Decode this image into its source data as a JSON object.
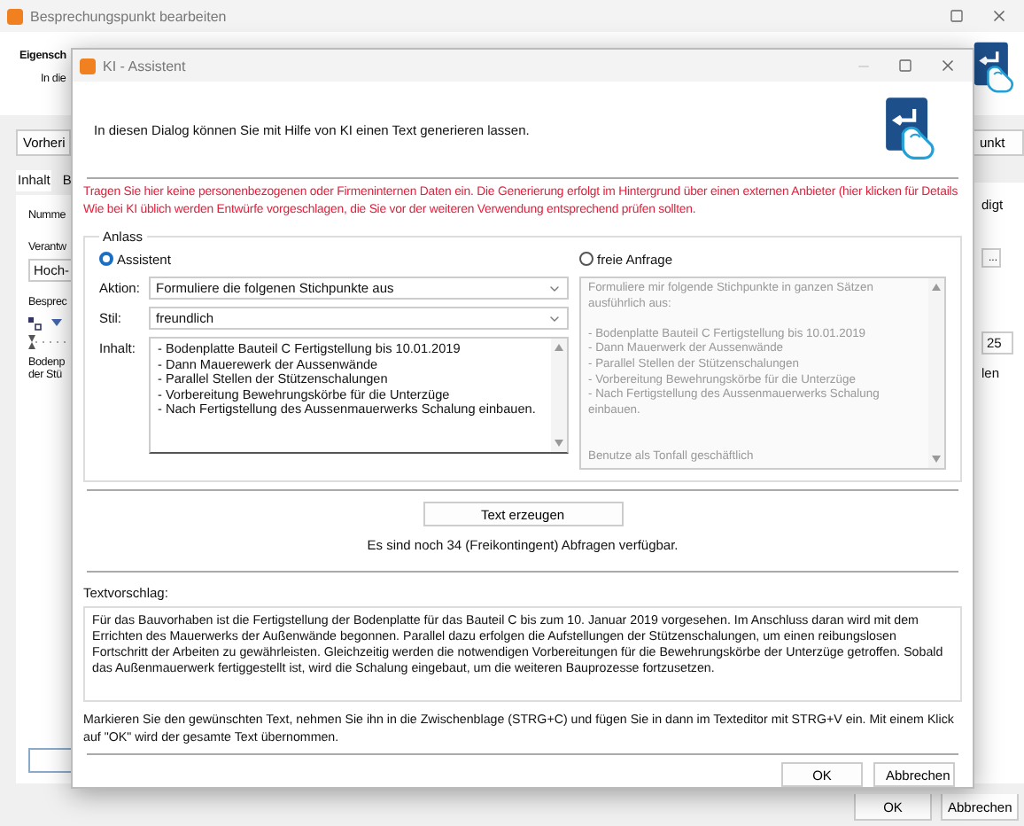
{
  "background_window": {
    "title": "Besprechungspunkt bearbeiten",
    "heading": "Eigensch",
    "intro": "In die",
    "prev_button": "Vorheri",
    "next_button": "unkt",
    "tabs": [
      {
        "label": "Inhalt",
        "selected": true
      },
      {
        "label": "B",
        "selected": false
      }
    ],
    "number_label": "Numme",
    "status_text": "digt",
    "responsible_label": "Verantw",
    "responsible_value": "Hoch-",
    "browse_button": "...",
    "section_label": "Besprec",
    "ruler_value": "25",
    "body_lines": [
      "Bodenp",
      "der Stü"
    ],
    "body_right": "len",
    "buttons": [
      "OK",
      "Abbrechen"
    ]
  },
  "dialog": {
    "title": "KI - Assistent",
    "intro": "In diesen Dialog können Sie mit Hilfe von KI einen Text generieren lassen.",
    "warning": [
      "Tragen Sie hier keine personenbezogenen oder Firmeninternen Daten ein. Die Generierung erfolgt im Hintergrund über einen externen Anbieter (hier klicken für Details",
      "Wie bei KI üblich werden Entwürfe vorgeschlagen, die Sie vor der weiteren Verwendung entsprechend prüfen sollten."
    ],
    "group_label": "Anlass",
    "modes": [
      {
        "label": "Assistent",
        "selected": true
      },
      {
        "label": "freie Anfrage",
        "selected": false
      }
    ],
    "action": {
      "label": "Aktion:",
      "value": "Formuliere die folgenen Stichpunkte aus"
    },
    "style": {
      "label": "Stil:",
      "value": "freundlich"
    },
    "content": {
      "label": "Inhalt:",
      "value": "- Bodenplatte Bauteil C Fertigstellung bis 10.01.2019\n- Dann Mauerewerk der Aussenwände\n- Parallel Stellen der Stützenschalungen\n- Vorbereitung Bewehrungskörbe für die Unterzüge\n- Nach Fertigstellung des Aussenmauerwerks Schalung einbauen."
    },
    "free_request": {
      "disabled": true,
      "value": "Formuliere mir folgende Stichpunkte in ganzen Sätzen ausführlich aus:\n\n- Bodenplatte Bauteil C Fertigstellung bis 10.01.2019\n- Dann Mauerwerk der Aussenwände\n- Parallel Stellen der Stützenschalungen\n- Vorbereitung Bewehrungskörbe für die Unterzüge\n- Nach Fertigstellung des Aussenmauerwerks Schalung einbauen.\n\n\nBenutze als Tonfall geschäftlich"
    },
    "generate_button": "Text erzeugen",
    "quota": "Es sind noch 34 (Freikontingent) Abfragen verfügbar.",
    "suggestion_label": "Textvorschlag:",
    "suggestion": "Für das Bauvorhaben ist die Fertigstellung der Bodenplatte für das Bauteil C bis zum 10. Januar 2019 vorgesehen. Im Anschluss daran wird mit dem Errichten des Mauerwerks der Außenwände begonnen. Parallel dazu erfolgen die Aufstellungen der Stützenschalungen, um einen reibungslosen Fortschritt der Arbeiten zu gewährleisten. Gleichzeitig werden die notwendigen Vorbereitungen für die Bewehrungskörbe der Unterzüge getroffen. Sobald das Außenmauerwerk fertiggestellt ist, wird die Schalung eingebaut, um die weiteren Bauprozesse fortzusetzen.",
    "note": "Markieren Sie den gewünschten Text, nehmen Sie ihn in die Zwischenblage (STRG+C) und fügen Sie in dann im Texteditor mit STRG+V ein. Mit einem Klick auf \"OK\" wird der gesamte Text übernommen.",
    "buttons": [
      "OK",
      "Abbrechen"
    ]
  }
}
